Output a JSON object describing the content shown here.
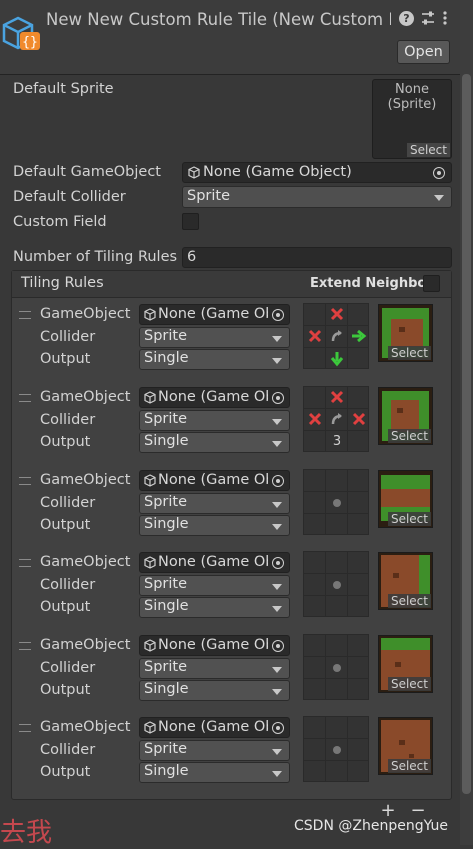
{
  "header": {
    "title": "New New Custom Rule Tile (New Custom R",
    "open_label": "Open",
    "icon_names": [
      "cube-icon",
      "help-icon",
      "presets-icon",
      "more-icon"
    ]
  },
  "inspector": {
    "default_sprite_label": "Default Sprite",
    "default_sprite_value": "None\n(Sprite)",
    "default_sprite_none": "None",
    "default_sprite_type": "(Sprite)",
    "select_label": "Select",
    "default_gameobject_label": "Default GameObject",
    "default_gameobject_value": "None (Game Object)",
    "default_collider_label": "Default Collider",
    "default_collider_value": "Sprite",
    "custom_field_label": "Custom Field",
    "num_rules_label": "Number of Tiling Rules",
    "num_rules_value": "6"
  },
  "tiling": {
    "title": "Tiling Rules",
    "extend_neighbor": "Extend Neighbor",
    "rules": [
      {
        "gameobject_label": "GameObject",
        "gameobject_value": "None (Game Ob",
        "collider_label": "Collider",
        "collider_value": "Sprite",
        "output_label": "Output",
        "output_value": "Single",
        "select": "Select"
      },
      {
        "gameobject_label": "GameObject",
        "gameobject_value": "None (Game Ob",
        "collider_label": "Collider",
        "collider_value": "Sprite",
        "output_label": "Output",
        "output_value": "Single",
        "select": "Select",
        "grid_number": "3"
      },
      {
        "gameobject_label": "GameObject",
        "gameobject_value": "None (Game Ob",
        "collider_label": "Collider",
        "collider_value": "Sprite",
        "output_label": "Output",
        "output_value": "Single",
        "select": "Select"
      },
      {
        "gameobject_label": "GameObject",
        "gameobject_value": "None (Game Ob",
        "collider_label": "Collider",
        "collider_value": "Sprite",
        "output_label": "Output",
        "output_value": "Single",
        "select": "Select"
      },
      {
        "gameobject_label": "GameObject",
        "gameobject_value": "None (Game Ob",
        "collider_label": "Collider",
        "collider_value": "Sprite",
        "output_label": "Output",
        "output_value": "Single",
        "select": "Select"
      },
      {
        "gameobject_label": "GameObject",
        "gameobject_value": "None (Game Ob",
        "collider_label": "Collider",
        "collider_value": "Sprite",
        "output_label": "Output",
        "output_value": "Single",
        "select": "Select"
      }
    ],
    "add_label": "+",
    "remove_label": "−"
  },
  "watermark": {
    "text": "CSDN @ZhenpengYue",
    "cjk": "去我"
  },
  "colors": {
    "accent_orange": "#f08a2c",
    "cube_blue": "#4aa3e0",
    "rule_red": "#e04040",
    "rule_green": "#3cc83c",
    "grass": "#3f8f2a",
    "dirt": "#8a4a2a"
  }
}
